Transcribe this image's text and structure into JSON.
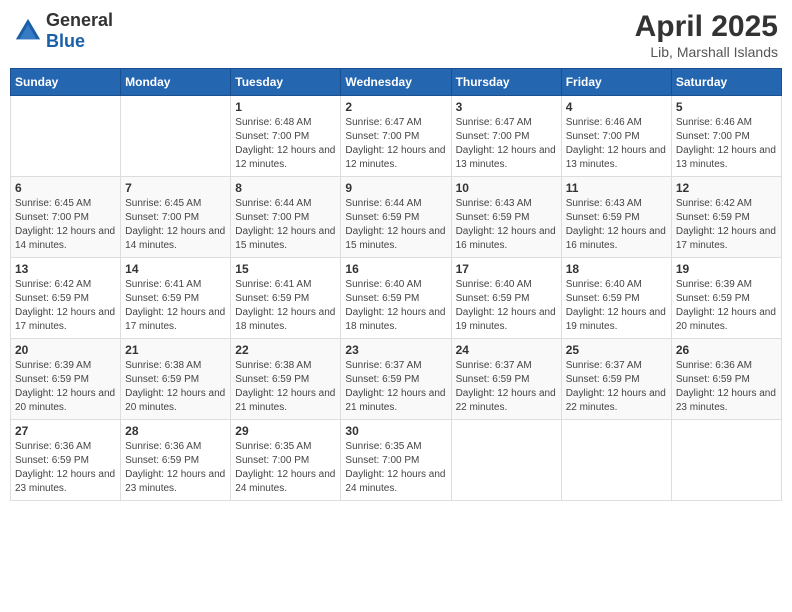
{
  "header": {
    "logo_general": "General",
    "logo_blue": "Blue",
    "month": "April 2025",
    "location": "Lib, Marshall Islands"
  },
  "weekdays": [
    "Sunday",
    "Monday",
    "Tuesday",
    "Wednesday",
    "Thursday",
    "Friday",
    "Saturday"
  ],
  "weeks": [
    [
      {
        "day": null,
        "sunrise": null,
        "sunset": null,
        "daylight": null
      },
      {
        "day": null,
        "sunrise": null,
        "sunset": null,
        "daylight": null
      },
      {
        "day": "1",
        "sunrise": "Sunrise: 6:48 AM",
        "sunset": "Sunset: 7:00 PM",
        "daylight": "Daylight: 12 hours and 12 minutes."
      },
      {
        "day": "2",
        "sunrise": "Sunrise: 6:47 AM",
        "sunset": "Sunset: 7:00 PM",
        "daylight": "Daylight: 12 hours and 12 minutes."
      },
      {
        "day": "3",
        "sunrise": "Sunrise: 6:47 AM",
        "sunset": "Sunset: 7:00 PM",
        "daylight": "Daylight: 12 hours and 13 minutes."
      },
      {
        "day": "4",
        "sunrise": "Sunrise: 6:46 AM",
        "sunset": "Sunset: 7:00 PM",
        "daylight": "Daylight: 12 hours and 13 minutes."
      },
      {
        "day": "5",
        "sunrise": "Sunrise: 6:46 AM",
        "sunset": "Sunset: 7:00 PM",
        "daylight": "Daylight: 12 hours and 13 minutes."
      }
    ],
    [
      {
        "day": "6",
        "sunrise": "Sunrise: 6:45 AM",
        "sunset": "Sunset: 7:00 PM",
        "daylight": "Daylight: 12 hours and 14 minutes."
      },
      {
        "day": "7",
        "sunrise": "Sunrise: 6:45 AM",
        "sunset": "Sunset: 7:00 PM",
        "daylight": "Daylight: 12 hours and 14 minutes."
      },
      {
        "day": "8",
        "sunrise": "Sunrise: 6:44 AM",
        "sunset": "Sunset: 7:00 PM",
        "daylight": "Daylight: 12 hours and 15 minutes."
      },
      {
        "day": "9",
        "sunrise": "Sunrise: 6:44 AM",
        "sunset": "Sunset: 6:59 PM",
        "daylight": "Daylight: 12 hours and 15 minutes."
      },
      {
        "day": "10",
        "sunrise": "Sunrise: 6:43 AM",
        "sunset": "Sunset: 6:59 PM",
        "daylight": "Daylight: 12 hours and 16 minutes."
      },
      {
        "day": "11",
        "sunrise": "Sunrise: 6:43 AM",
        "sunset": "Sunset: 6:59 PM",
        "daylight": "Daylight: 12 hours and 16 minutes."
      },
      {
        "day": "12",
        "sunrise": "Sunrise: 6:42 AM",
        "sunset": "Sunset: 6:59 PM",
        "daylight": "Daylight: 12 hours and 17 minutes."
      }
    ],
    [
      {
        "day": "13",
        "sunrise": "Sunrise: 6:42 AM",
        "sunset": "Sunset: 6:59 PM",
        "daylight": "Daylight: 12 hours and 17 minutes."
      },
      {
        "day": "14",
        "sunrise": "Sunrise: 6:41 AM",
        "sunset": "Sunset: 6:59 PM",
        "daylight": "Daylight: 12 hours and 17 minutes."
      },
      {
        "day": "15",
        "sunrise": "Sunrise: 6:41 AM",
        "sunset": "Sunset: 6:59 PM",
        "daylight": "Daylight: 12 hours and 18 minutes."
      },
      {
        "day": "16",
        "sunrise": "Sunrise: 6:40 AM",
        "sunset": "Sunset: 6:59 PM",
        "daylight": "Daylight: 12 hours and 18 minutes."
      },
      {
        "day": "17",
        "sunrise": "Sunrise: 6:40 AM",
        "sunset": "Sunset: 6:59 PM",
        "daylight": "Daylight: 12 hours and 19 minutes."
      },
      {
        "day": "18",
        "sunrise": "Sunrise: 6:40 AM",
        "sunset": "Sunset: 6:59 PM",
        "daylight": "Daylight: 12 hours and 19 minutes."
      },
      {
        "day": "19",
        "sunrise": "Sunrise: 6:39 AM",
        "sunset": "Sunset: 6:59 PM",
        "daylight": "Daylight: 12 hours and 20 minutes."
      }
    ],
    [
      {
        "day": "20",
        "sunrise": "Sunrise: 6:39 AM",
        "sunset": "Sunset: 6:59 PM",
        "daylight": "Daylight: 12 hours and 20 minutes."
      },
      {
        "day": "21",
        "sunrise": "Sunrise: 6:38 AM",
        "sunset": "Sunset: 6:59 PM",
        "daylight": "Daylight: 12 hours and 20 minutes."
      },
      {
        "day": "22",
        "sunrise": "Sunrise: 6:38 AM",
        "sunset": "Sunset: 6:59 PM",
        "daylight": "Daylight: 12 hours and 21 minutes."
      },
      {
        "day": "23",
        "sunrise": "Sunrise: 6:37 AM",
        "sunset": "Sunset: 6:59 PM",
        "daylight": "Daylight: 12 hours and 21 minutes."
      },
      {
        "day": "24",
        "sunrise": "Sunrise: 6:37 AM",
        "sunset": "Sunset: 6:59 PM",
        "daylight": "Daylight: 12 hours and 22 minutes."
      },
      {
        "day": "25",
        "sunrise": "Sunrise: 6:37 AM",
        "sunset": "Sunset: 6:59 PM",
        "daylight": "Daylight: 12 hours and 22 minutes."
      },
      {
        "day": "26",
        "sunrise": "Sunrise: 6:36 AM",
        "sunset": "Sunset: 6:59 PM",
        "daylight": "Daylight: 12 hours and 23 minutes."
      }
    ],
    [
      {
        "day": "27",
        "sunrise": "Sunrise: 6:36 AM",
        "sunset": "Sunset: 6:59 PM",
        "daylight": "Daylight: 12 hours and 23 minutes."
      },
      {
        "day": "28",
        "sunrise": "Sunrise: 6:36 AM",
        "sunset": "Sunset: 6:59 PM",
        "daylight": "Daylight: 12 hours and 23 minutes."
      },
      {
        "day": "29",
        "sunrise": "Sunrise: 6:35 AM",
        "sunset": "Sunset: 7:00 PM",
        "daylight": "Daylight: 12 hours and 24 minutes."
      },
      {
        "day": "30",
        "sunrise": "Sunrise: 6:35 AM",
        "sunset": "Sunset: 7:00 PM",
        "daylight": "Daylight: 12 hours and 24 minutes."
      },
      {
        "day": null,
        "sunrise": null,
        "sunset": null,
        "daylight": null
      },
      {
        "day": null,
        "sunrise": null,
        "sunset": null,
        "daylight": null
      },
      {
        "day": null,
        "sunrise": null,
        "sunset": null,
        "daylight": null
      }
    ]
  ]
}
